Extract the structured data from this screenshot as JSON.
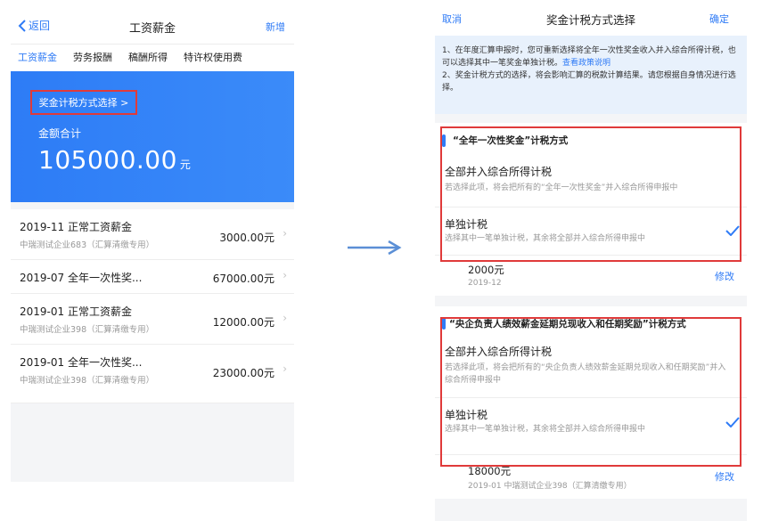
{
  "left": {
    "nav": {
      "back_label": "返回",
      "title": "工资薪金",
      "action_label": "新增"
    },
    "tabs": [
      "工资薪金",
      "劳务报酬",
      "稿酬所得",
      "特许权使用费"
    ],
    "hero": {
      "select_label": "奖金计税方式选择 >",
      "sum_label": "金额合计",
      "sum_value": "105000.00",
      "sum_unit": "元"
    },
    "rows": [
      {
        "title": "2019-11 正常工资薪金",
        "sub": "中瑞测试企业683（汇算清缴专用）",
        "amount": "3000.00元"
      },
      {
        "title": "2019-07 全年一次性奖...",
        "sub": "",
        "amount": "67000.00元"
      },
      {
        "title": "2019-01 正常工资薪金",
        "sub": "中瑞测试企业398（汇算清缴专用）",
        "amount": "12000.00元"
      },
      {
        "title": "2019-01 全年一次性奖...",
        "sub": "中瑞测试企业398（汇算清缴专用）",
        "amount": "23000.00元"
      }
    ]
  },
  "right": {
    "nav": {
      "cancel_label": "取消",
      "title": "奖金计税方式选择",
      "ok_label": "确定"
    },
    "notice": {
      "line1": "1、在年度汇算申报时，您可重新选择将全年一次性奖金收入并入综合所得计税，也可以选择其中一笔奖金单独计税。",
      "link": "查看政策说明",
      "line2": "2、奖金计税方式的选择，将会影响汇算的税款计算结果。请您根据自身情况进行选择。"
    },
    "section1": {
      "heading": "“全年一次性奖金”计税方式",
      "opt1_title": "全部并入综合所得计税",
      "opt1_desc": "若选择此项，将会把所有的“全年一次性奖金”并入综合所得申报中",
      "opt2_title": "单独计税",
      "opt2_desc": "选择其中一笔单独计税，其余将全部并入综合所得申报中",
      "entry_amount": "2000元",
      "entry_date": "2019-12",
      "edit_label": "修改"
    },
    "section2": {
      "heading": "“央企负责人绩效薪金延期兑现收入和任期奖励”计税方式",
      "opt1_title": "全部并入综合所得计税",
      "opt1_desc": "若选择此项，将会把所有的“央企负责人绩效薪金延期兑现收入和任期奖励”并入综合所得申报中",
      "opt2_title": "单独计税",
      "opt2_desc": "选择其中一笔单独计税，其余将全部并入综合所得申报中",
      "entry_amount": "18000元",
      "entry_date": "2019-01 中瑞测试企业398（汇算清缴专用）",
      "edit_label": "修改"
    }
  },
  "colors": {
    "accent": "#2f7bf6",
    "highlight_box": "#e03a3a",
    "hero_bg": "#2d7cf6"
  }
}
